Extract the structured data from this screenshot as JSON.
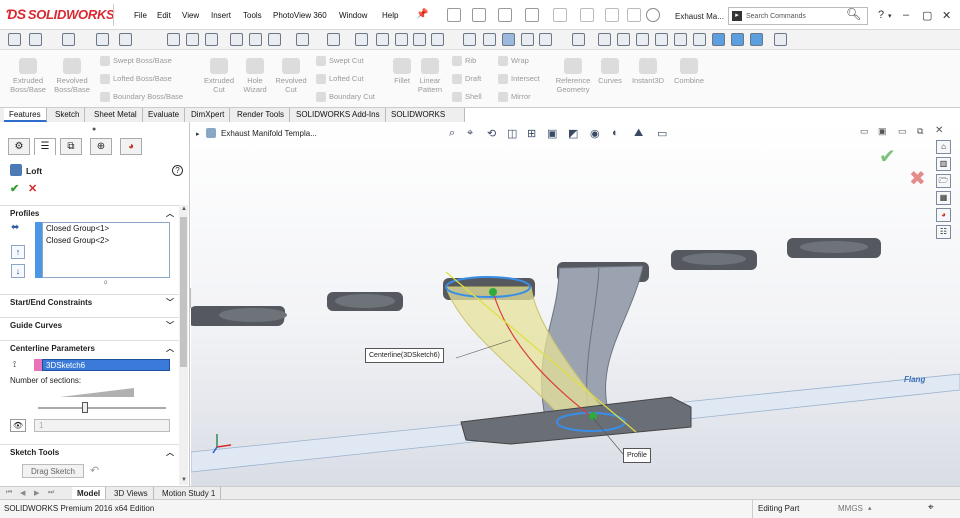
{
  "app": {
    "logo": "SOLIDWORKS",
    "document_title": "Exhaust Ma...",
    "search_placeholder": "Search Commands"
  },
  "menu": [
    "File",
    "Edit",
    "View",
    "Insert",
    "Tools",
    "PhotoView 360",
    "Window",
    "Help"
  ],
  "command_manager": {
    "extruded_boss": "Extruded\nBoss/Base",
    "revolved_boss": "Revolved\nBoss/Base",
    "swept_boss": "Swept Boss/Base",
    "lofted_boss": "Lofted Boss/Base",
    "boundary_boss": "Boundary Boss/Base",
    "extruded_cut": "Extruded\nCut",
    "hole_wizard": "Hole\nWizard",
    "revolved_cut": "Revolved\nCut",
    "swept_cut": "Swept Cut",
    "lofted_cut": "Lofted Cut",
    "boundary_cut": "Boundary Cut",
    "fillet": "Fillet",
    "linear_pattern": "Linear\nPattern",
    "rib": "Rib",
    "draft": "Draft",
    "shell": "Shell",
    "wrap": "Wrap",
    "intersect": "Intersect",
    "mirror": "Mirror",
    "reference_geometry": "Reference\nGeometry",
    "curves": "Curves",
    "instant3d": "Instant3D",
    "combine": "Combine"
  },
  "tabs": [
    "Features",
    "Sketch",
    "Sheet Metal",
    "Evaluate",
    "DimXpert",
    "Render Tools",
    "SOLIDWORKS Add-Ins",
    "SOLIDWORKS MBD"
  ],
  "property_manager": {
    "title": "Loft",
    "profiles": {
      "heading": "Profiles",
      "items": [
        "Closed Group<1>",
        "Closed Group<2>"
      ]
    },
    "start_end_constraints": "Start/End Constraints",
    "guide_curves": "Guide Curves",
    "centerline_parameters": {
      "heading": "Centerline Parameters",
      "sketch": "3DSketch6",
      "sections_label": "Number of sections:",
      "sections_value": "1"
    },
    "sketch_tools": {
      "heading": "Sketch Tools",
      "drag_sketch": "Drag Sketch"
    }
  },
  "viewport": {
    "tree_item": "Exhaust Manifold Templa...",
    "callout_centerline": "Centerline(3DSketch6)",
    "callout_profile": "Profile",
    "flange_label": "Flang"
  },
  "bottom_tabs": [
    "Model",
    "3D Views",
    "Motion Study 1"
  ],
  "status": {
    "edition": "SOLIDWORKS Premium 2016 x64 Edition",
    "mode": "Editing Part",
    "units": "MMGS"
  },
  "colors": {
    "brand": "#d9282f",
    "selection_blue": "#3b7ad8",
    "loft_preview": "#e6e29a"
  }
}
